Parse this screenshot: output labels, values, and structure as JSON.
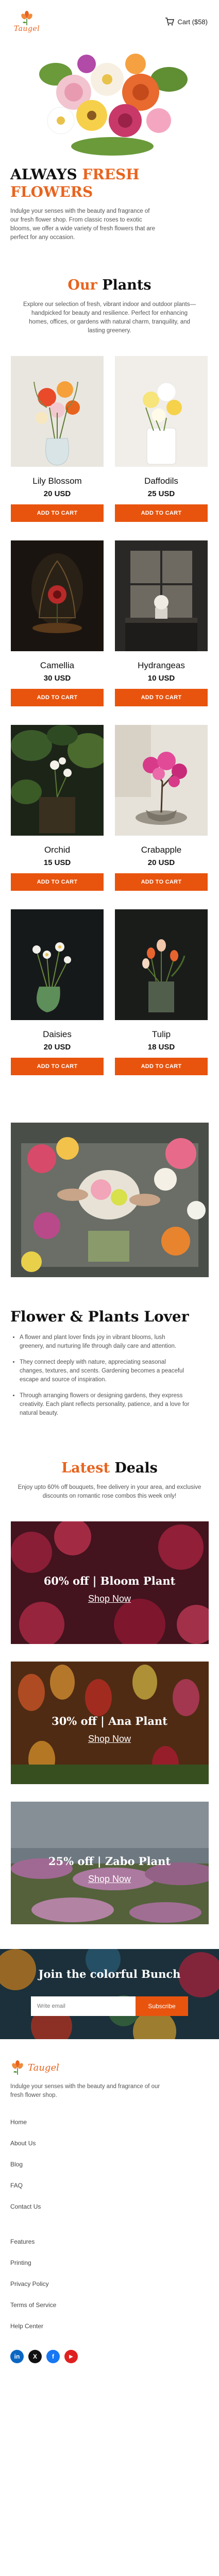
{
  "header": {
    "logo_text": "Taugel",
    "cart_label": "Cart ($58)"
  },
  "hero": {
    "title_line1": "ALWAYS",
    "title_accent": "FRESH",
    "title_line2": "FLOWERS",
    "text": "Indulge your senses with the beauty and fragrance of our fresh flower shop. From classic roses to exotic blooms, we offer a wide variety of fresh flowers that are perfect for any occasion."
  },
  "plants_section": {
    "title_accent": "Our",
    "title_rest": "Plants",
    "text": "Explore our selection of fresh, vibrant indoor and outdoor plants—handpicked for beauty and resilience. Perfect for enhancing homes, offices, or gardens with natural charm, tranquility, and lasting greenery."
  },
  "products": [
    {
      "name": "Lily Blossom",
      "price": "20 USD",
      "button": "ADD TO CART"
    },
    {
      "name": "Daffodils",
      "price": "25 USD",
      "button": "ADD TO CART"
    },
    {
      "name": "Camellia",
      "price": "30 USD",
      "button": "ADD TO CART"
    },
    {
      "name": "Hydrangeas",
      "price": "10 USD",
      "button": "ADD TO CART"
    },
    {
      "name": "Orchid",
      "price": "15 USD",
      "button": "ADD TO CART"
    },
    {
      "name": "Crabapple",
      "price": "20 USD",
      "button": "ADD TO CART"
    },
    {
      "name": "Daisies",
      "price": "20 USD",
      "button": "ADD TO CART"
    },
    {
      "name": "Tulip",
      "price": "18 USD",
      "button": "ADD TO CART"
    }
  ],
  "lover": {
    "title": "Flower & Plants Lover",
    "items": [
      "A flower and plant lover finds joy in vibrant blooms, lush greenery, and nurturing life through daily care and attention.",
      "They connect deeply with nature, appreciating seasonal changes, textures, and scents. Gardening becomes a peaceful escape and source of inspiration.",
      "Through arranging flowers or designing gardens, they express creativity. Each plant reflects personality, patience, and a love for natural beauty."
    ]
  },
  "deals_section": {
    "title_accent": "Latest",
    "title_rest": "Deals",
    "text": "Enjoy upto 60% off bouquets, free delivery in your area, and exclusive discounts on romantic rose combos this week only!",
    "deals": [
      {
        "label": "60% off | Bloom Plant",
        "link": "Shop Now"
      },
      {
        "label": "30% off | Ana Plant",
        "link": "Shop Now"
      },
      {
        "label": "25% off | Zabo Plant",
        "link": "Shop Now"
      }
    ]
  },
  "newsletter": {
    "title": "Join the colorful Bunch",
    "placeholder": "Write email",
    "button": "Subscribe"
  },
  "footer": {
    "logo_text": "Taugel",
    "text": "Indulge your senses with the beauty and fragrance of our fresh flower shop.",
    "links": [
      "Home",
      "About Us",
      "Blog",
      "FAQ",
      "Contact Us",
      "Features",
      "Printing",
      "Privacy Policy",
      "Terms of Service",
      "Help Center"
    ],
    "socials": [
      {
        "name": "linkedin",
        "glyph": "in",
        "color": "#0a66c2"
      },
      {
        "name": "twitter-x",
        "glyph": "X",
        "color": "#111111"
      },
      {
        "name": "facebook",
        "glyph": "f",
        "color": "#1877f2"
      },
      {
        "name": "youtube",
        "glyph": "▶",
        "color": "#e02020"
      }
    ]
  },
  "colors": {
    "accent": "#e8641e",
    "button": "#e8540e"
  }
}
